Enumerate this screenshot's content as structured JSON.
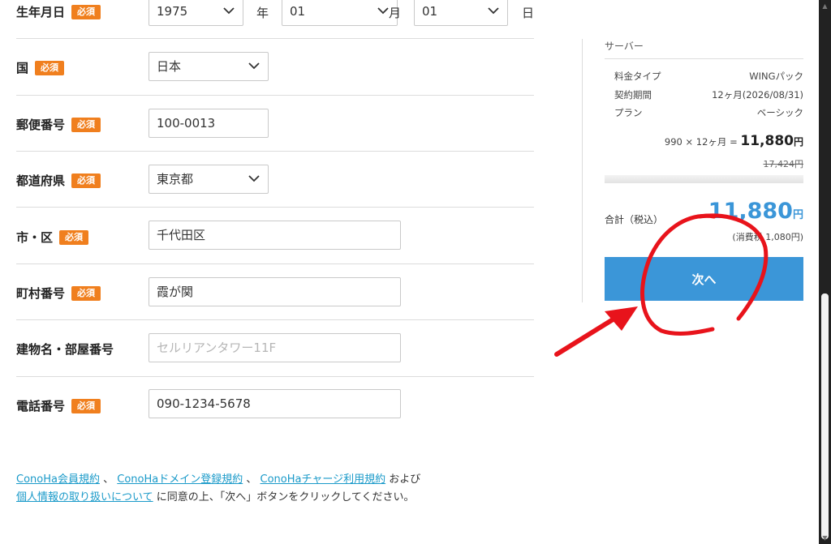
{
  "required_badge": "必須",
  "form": {
    "birth": {
      "label": "生年月日",
      "year": "1975",
      "year_unit": "年",
      "month": "01",
      "month_unit": "月",
      "day": "01",
      "day_unit": "日"
    },
    "country": {
      "label": "国",
      "value": "日本"
    },
    "postal": {
      "label": "郵便番号",
      "value": "100-0013"
    },
    "prefecture": {
      "label": "都道府県",
      "value": "東京都"
    },
    "city": {
      "label": "市・区",
      "value": "千代田区"
    },
    "town": {
      "label": "町村番号",
      "value": "霞が関"
    },
    "building": {
      "label": "建物名・部屋番号",
      "placeholder": "セルリアンタワー11F"
    },
    "phone": {
      "label": "電話番号",
      "value": "090-1234-5678"
    }
  },
  "terms": {
    "link1": "ConoHa会員規約",
    "sep1": "、",
    "link2": "ConoHaドメイン登録規約",
    "sep2": "、",
    "link3": "ConoHaチャージ利用規約",
    "text1": "および",
    "link4": "個人情報の取り扱いについて",
    "text2": "に同意の上、「次へ」ボタンをクリックしてください。"
  },
  "summary": {
    "section": "サーバー",
    "plan_type_label": "料金タイプ",
    "plan_type_value": "WINGパック",
    "period_label": "契約期間",
    "period_value": "12ヶ月(2026/08/31)",
    "plan_label": "プラン",
    "plan_value": "ベーシック",
    "calc_text": "990 × 12ヶ月 =",
    "price": "11,880",
    "yen": "円",
    "original_price": "17,424円",
    "total_label": "合計（税込）",
    "total": "11,880",
    "tax_note": "(消費税 1,080円)",
    "next_button": "次へ"
  },
  "colors": {
    "accent_blue": "#3b96d8",
    "required_orange": "#f07f1e",
    "link": "#1a9ac9",
    "annotation_red": "#e8131b"
  }
}
